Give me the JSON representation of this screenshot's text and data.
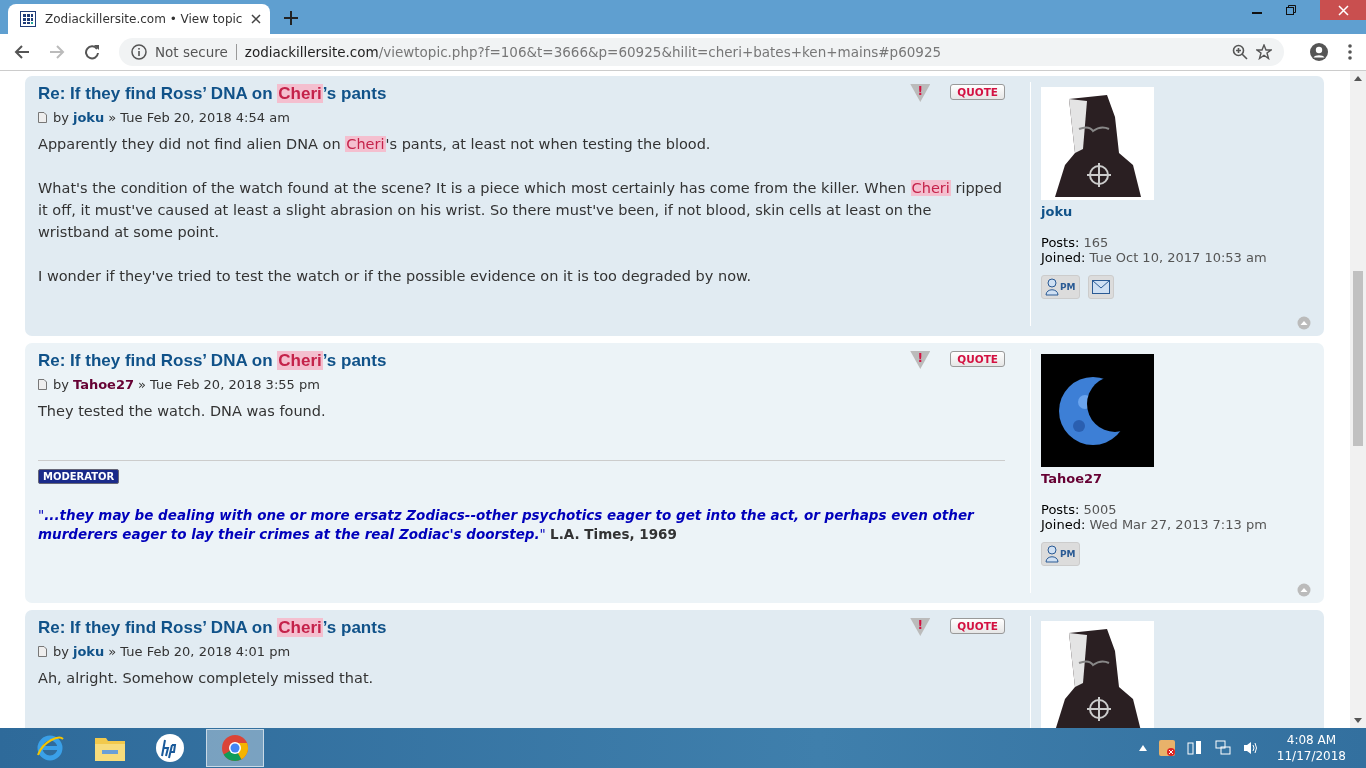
{
  "browser": {
    "tab_title": "Zodiackillersite.com • View topic",
    "security": "Not secure",
    "url_host": "zodiackillersite.com",
    "url_path": "/viewtopic.php?f=106&t=3666&p=60925&hilit=cheri+bates+ken+mains#p60925"
  },
  "posts": [
    {
      "title": [
        {
          "text": "Re: If they find Ross’ DNA on ",
          "highlight": false
        },
        {
          "text": "Cheri",
          "highlight": true
        },
        {
          "text": "’s pants",
          "highlight": false
        }
      ],
      "by": "by",
      "author": {
        "name": "joku",
        "color": "#105289"
      },
      "sep": "»",
      "date": "Tue Feb 20, 2018 4:54 am",
      "report_label": "!",
      "quote_label": "QUOTE",
      "body": [
        [
          {
            "text": "Apparently they did not find alien DNA on ",
            "highlight": false
          },
          {
            "text": "Cheri",
            "highlight": true
          },
          {
            "text": "'s pants, at least not when testing the blood.",
            "highlight": false
          }
        ],
        [
          {
            "text": "What's the condition of the watch found at the scene? It is a piece which most certainly has come from the killer. When ",
            "highlight": false
          },
          {
            "text": "Cheri",
            "highlight": true
          },
          {
            "text": " ripped it off, it must've caused at least a slight abrasion on his wrist. So there must've been, if not blood, skin cells at least on the wristband at some point.",
            "highlight": false
          }
        ],
        [
          {
            "text": "I wonder if they've tried to test the watch or if the possible evidence on it is too degraded by now.",
            "highlight": false
          }
        ]
      ],
      "avatar": {
        "kind": "hood"
      },
      "profile": {
        "username": "joku",
        "color": "#105289",
        "posts_label": "Posts:",
        "posts": "165",
        "joined_label": "Joined:",
        "joined": "Tue Oct 10, 2017 10:53 am",
        "pm_label": "PM",
        "email": true
      }
    },
    {
      "title": [
        {
          "text": "Re: If they find Ross’ DNA on ",
          "highlight": false
        },
        {
          "text": "Cheri",
          "highlight": true
        },
        {
          "text": "’s pants",
          "highlight": false
        }
      ],
      "by": "by",
      "author": {
        "name": "Tahoe27",
        "color": "#660033"
      },
      "sep": "»",
      "date": "Tue Feb 20, 2018 3:55 pm",
      "report_label": "!",
      "quote_label": "QUOTE",
      "body": [
        [
          {
            "text": "They tested the watch. DNA was found.",
            "highlight": false
          }
        ]
      ],
      "signature": {
        "badge": "MODERATOR",
        "open_mark": "\"",
        "quote": "...they may be dealing with one or more ersatz Zodiacs--other psychotics eager to get into the act, or perhaps even other murderers eager to lay their crimes at the real Zodiac's doorstep.",
        "close_mark": "\"",
        "source": "L.A. Times, 1969"
      },
      "avatar": {
        "kind": "moon"
      },
      "profile": {
        "username": "Tahoe27",
        "color": "#660033",
        "posts_label": "Posts:",
        "posts": "5005",
        "joined_label": "Joined:",
        "joined": "Wed Mar 27, 2013 7:13 pm",
        "pm_label": "PM",
        "email": false
      }
    },
    {
      "title": [
        {
          "text": "Re: If they find Ross’ DNA on ",
          "highlight": false
        },
        {
          "text": "Cheri",
          "highlight": true
        },
        {
          "text": "’s pants",
          "highlight": false
        }
      ],
      "by": "by",
      "author": {
        "name": "joku",
        "color": "#105289"
      },
      "sep": "»",
      "date": "Tue Feb 20, 2018 4:01 pm",
      "report_label": "!",
      "quote_label": "QUOTE",
      "body": [
        [
          {
            "text": "Ah, alright. Somehow completely missed that.",
            "highlight": false
          }
        ]
      ],
      "avatar": {
        "kind": "hood"
      }
    }
  ],
  "taskbar": {
    "apps": [
      {
        "kind": "ie",
        "selected": false
      },
      {
        "kind": "explorer",
        "selected": false
      },
      {
        "kind": "hp",
        "selected": false
      },
      {
        "kind": "chrome",
        "selected": true
      }
    ],
    "time": "4:08 AM",
    "date": "11/17/2018"
  }
}
